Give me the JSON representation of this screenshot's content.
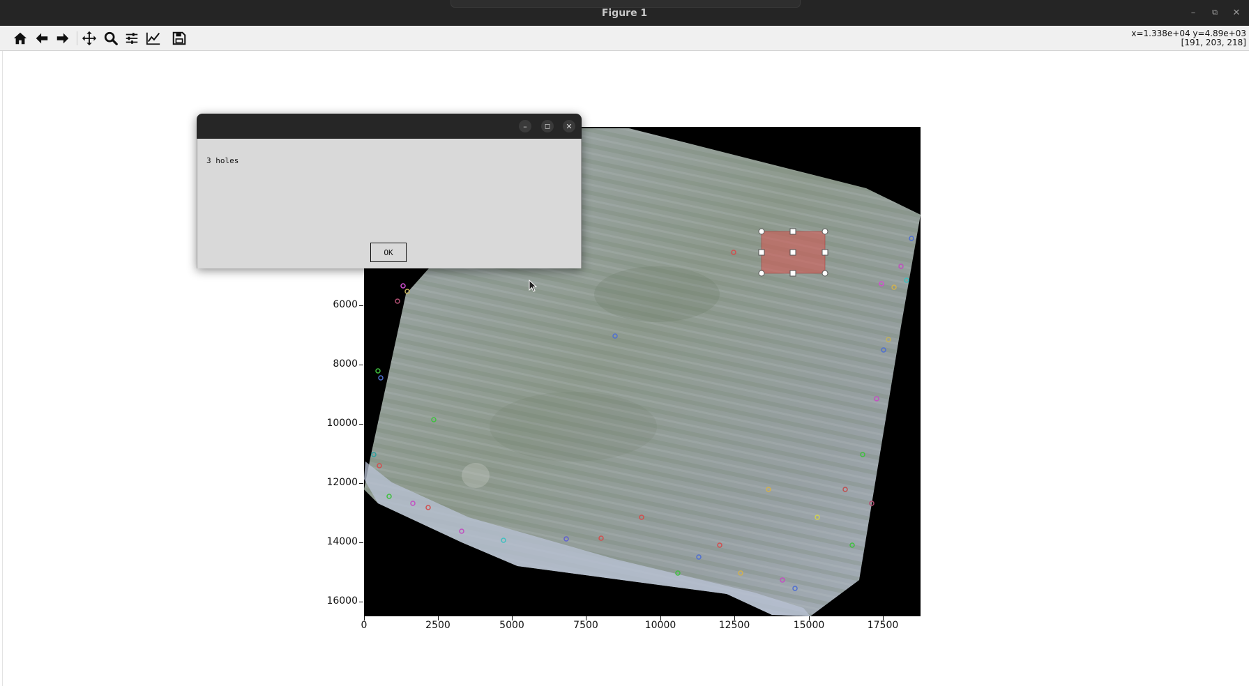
{
  "window": {
    "title": "Figure 1",
    "controls": [
      "minimize",
      "restore",
      "close"
    ]
  },
  "toolbar": {
    "buttons": [
      {
        "name": "home-icon",
        "tooltip": "Reset original view"
      },
      {
        "name": "back-arrow-icon",
        "tooltip": "Back"
      },
      {
        "name": "forward-arrow-icon",
        "tooltip": "Forward"
      },
      {
        "name": "pan-icon",
        "tooltip": "Pan"
      },
      {
        "name": "zoom-icon",
        "tooltip": "Zoom"
      },
      {
        "name": "configure-subplots-icon",
        "tooltip": "Subplots"
      },
      {
        "name": "edit-axis-icon",
        "tooltip": "Customize"
      },
      {
        "name": "save-icon",
        "tooltip": "Save"
      }
    ],
    "coord_readout": "x=1.338e+04 y=4.89e+03",
    "pixel_readout": "[191, 203, 218]"
  },
  "figure": {
    "y_ticks": [
      "6000",
      "8000",
      "10000",
      "12000",
      "14000",
      "16000"
    ],
    "x_ticks": [
      "0",
      "2500",
      "5000",
      "7500",
      "10000",
      "12500",
      "15000",
      "17500"
    ],
    "selection_color": "#d9534f"
  },
  "dialog": {
    "message": "3 holes",
    "ok_label": "OK"
  }
}
